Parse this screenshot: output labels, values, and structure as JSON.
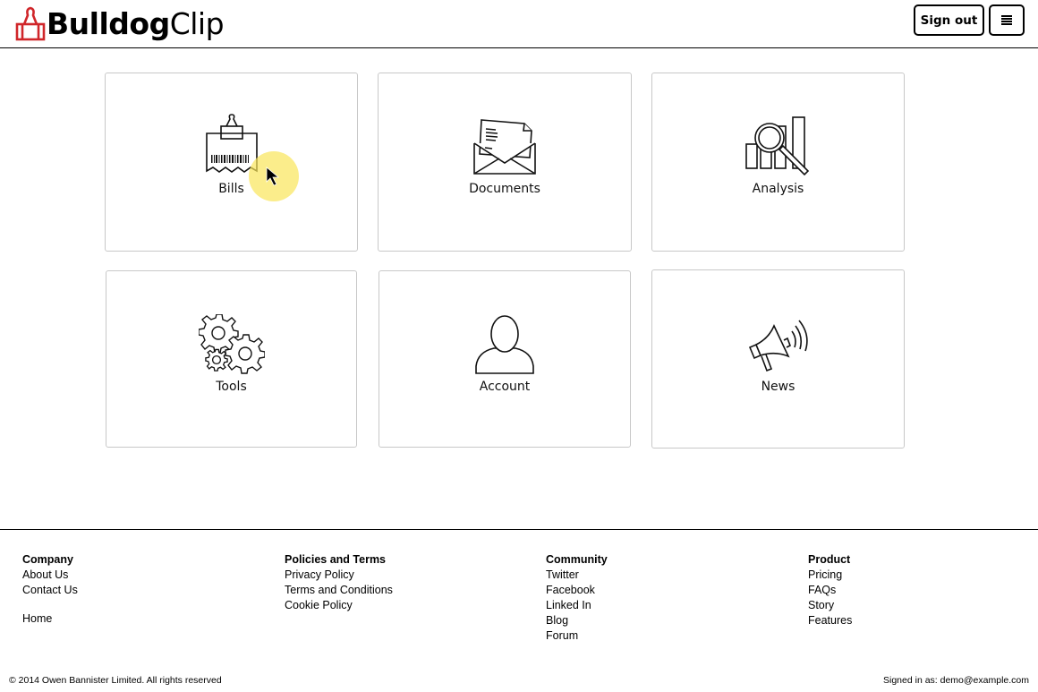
{
  "header": {
    "logo_bold": "Bulldog",
    "logo_light": "Clip",
    "brand_color": "#d0262a",
    "sign_out_label": "Sign out",
    "menu_icon": "hamburger-menu-icon"
  },
  "tiles": [
    {
      "label": "Bills",
      "icon": "bill-receipt-icon"
    },
    {
      "label": "Documents",
      "icon": "envelope-document-icon"
    },
    {
      "label": "Analysis",
      "icon": "bar-chart-magnifier-icon"
    },
    {
      "label": "Tools",
      "icon": "gears-icon"
    },
    {
      "label": "Account",
      "icon": "user-icon"
    },
    {
      "label": "News",
      "icon": "megaphone-icon"
    }
  ],
  "footer": {
    "columns": [
      {
        "heading": "Company",
        "links": [
          "About Us",
          "Contact Us",
          "Home"
        ]
      },
      {
        "heading": "Policies and Terms",
        "links": [
          "Privacy Policy",
          "Terms and Conditions",
          "Cookie Policy"
        ]
      },
      {
        "heading": "Community",
        "links": [
          "Twitter",
          "Facebook",
          "Linked In",
          "Blog",
          "Forum"
        ]
      },
      {
        "heading": "Product",
        "links": [
          "Pricing",
          "FAQs",
          "Story",
          "Features"
        ]
      }
    ],
    "copyright": "© 2014 Owen Bannister Limited. All rights reserved",
    "signed_in": "Signed in as: demo@example.com"
  }
}
